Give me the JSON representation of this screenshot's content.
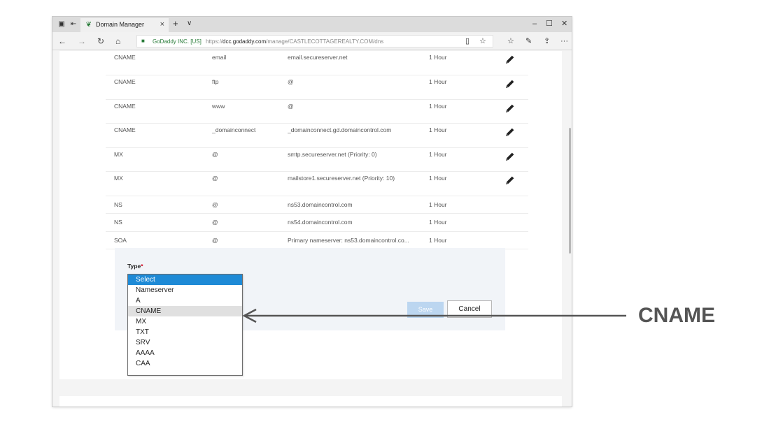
{
  "window": {
    "tab_title": "Domain Manager",
    "tab_close": "×",
    "new_tab": "+",
    "tab_menu": "∨",
    "minimize": "–",
    "maximize": "☐",
    "close": "✕"
  },
  "addressbar": {
    "back": "←",
    "forward": "→",
    "refresh": "↻",
    "home": "⌂",
    "site_identity": "GoDaddy INC. [US]",
    "url_prefix": "https://",
    "url_domain": "dcc.godaddy.com",
    "url_path": "/manage/CASTLECOTTAGEREALTY.COM/dns",
    "reading_view": "▯",
    "favorite": "☆",
    "favorites_hub": "☆",
    "notes": "✎",
    "share": "⇪",
    "more": "···"
  },
  "records": [
    {
      "type": "CNAME",
      "name": "email",
      "value": "email.secureserver.net",
      "ttl": "1 Hour",
      "editable": true
    },
    {
      "type": "CNAME",
      "name": "ftp",
      "value": "@",
      "ttl": "1 Hour",
      "editable": true
    },
    {
      "type": "CNAME",
      "name": "www",
      "value": "@",
      "ttl": "1 Hour",
      "editable": true
    },
    {
      "type": "CNAME",
      "name": "_domainconnect",
      "value": "_domainconnect.gd.domaincontrol.com",
      "ttl": "1 Hour",
      "editable": true
    },
    {
      "type": "MX",
      "name": "@",
      "value": "smtp.secureserver.net (Priority: 0)",
      "ttl": "1 Hour",
      "editable": true
    },
    {
      "type": "MX",
      "name": "@",
      "value": "mailstore1.secureserver.net (Priority: 10)",
      "ttl": "1 Hour",
      "editable": true
    },
    {
      "type": "NS",
      "name": "@",
      "value": "ns53.domaincontrol.com",
      "ttl": "1 Hour",
      "editable": false
    },
    {
      "type": "NS",
      "name": "@",
      "value": "ns54.domaincontrol.com",
      "ttl": "1 Hour",
      "editable": false
    },
    {
      "type": "SOA",
      "name": "@",
      "value": "Primary nameserver: ns53.domaincontrol.co...",
      "ttl": "1 Hour",
      "editable": false
    }
  ],
  "form": {
    "type_label": "Type",
    "required_mark": "*",
    "save_label": "Save",
    "cancel_label": "Cancel"
  },
  "type_dropdown": {
    "options": [
      "Select",
      "Nameserver",
      "A",
      "CNAME",
      "MX",
      "TXT",
      "SRV",
      "AAAA",
      "CAA"
    ],
    "selected": "Select",
    "highlighted": "CNAME"
  },
  "annotation": {
    "label": "CNAME"
  },
  "colors": {
    "selected_option": "#1e8ad6",
    "secure_green": "#2a7c3a",
    "callout_gray": "#555555",
    "required_red": "#d0021b"
  }
}
